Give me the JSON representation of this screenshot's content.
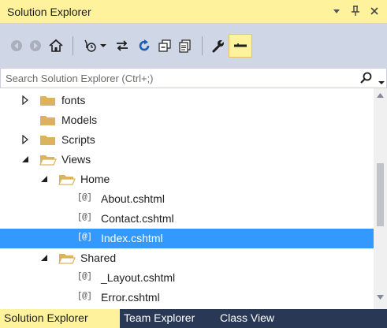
{
  "window": {
    "title": "Solution Explorer",
    "pin_glyph": "ᛘ"
  },
  "toolbar": {
    "icons": [
      "back-icon",
      "forward-icon",
      "home-icon",
      "pending-changes-filter-icon",
      "sync-icon",
      "refresh-icon",
      "collapse-all-icon",
      "show-all-files-icon",
      "properties-icon",
      "preview-icon"
    ]
  },
  "search": {
    "placeholder": "Search Solution Explorer (Ctrl+;)",
    "value": ""
  },
  "tree": {
    "items": [
      {
        "label": "fonts",
        "type": "folder",
        "level": 2,
        "expander": "collapsed"
      },
      {
        "label": "Models",
        "type": "folder",
        "level": 2,
        "expander": "none"
      },
      {
        "label": "Scripts",
        "type": "folder",
        "level": 2,
        "expander": "collapsed"
      },
      {
        "label": "Views",
        "type": "folder-open",
        "level": 2,
        "expander": "expanded"
      },
      {
        "label": "Home",
        "type": "folder-open",
        "level": 3,
        "expander": "expanded"
      },
      {
        "label": "About.cshtml",
        "type": "file",
        "level": 4,
        "expander": "none"
      },
      {
        "label": "Contact.cshtml",
        "type": "file",
        "level": 4,
        "expander": "none"
      },
      {
        "label": "Index.cshtml",
        "type": "file",
        "level": 4,
        "expander": "none",
        "selected": true
      },
      {
        "label": "Shared",
        "type": "folder-open",
        "level": 3,
        "expander": "expanded"
      },
      {
        "label": "_Layout.cshtml",
        "type": "file",
        "level": 4,
        "expander": "none"
      },
      {
        "label": "Error.cshtml",
        "type": "file",
        "level": 4,
        "expander": "none"
      }
    ],
    "file_badge": "[@]"
  },
  "tabs": [
    {
      "label": "Solution Explorer",
      "active": true
    },
    {
      "label": "Team Explorer",
      "active": false
    },
    {
      "label": "Class View",
      "active": false
    }
  ],
  "colors": {
    "title_bar": "#fff29d",
    "toolbar": "#cfd6e5",
    "selection": "#3399ff",
    "tab_strip": "#293955",
    "folder": "#dcb35c"
  }
}
